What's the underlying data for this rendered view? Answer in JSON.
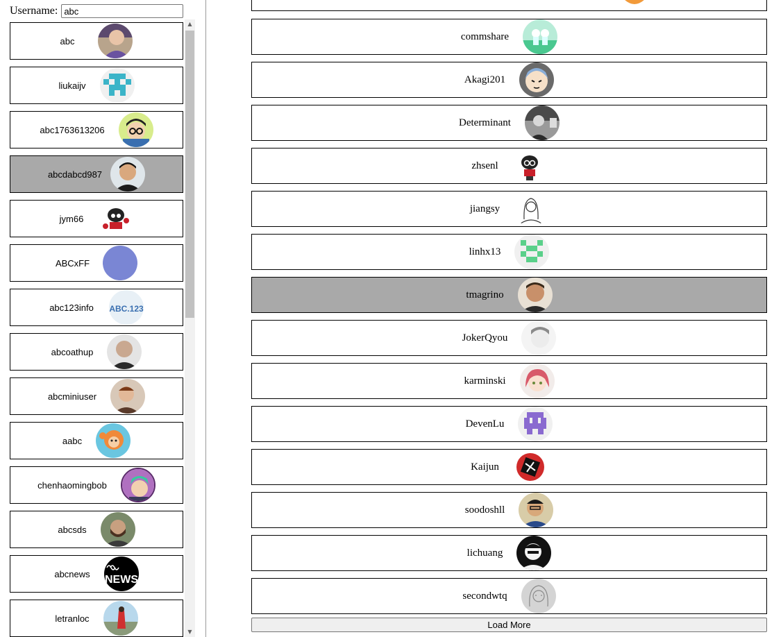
{
  "search": {
    "label": "Username:",
    "value": "abc"
  },
  "results": [
    {
      "login": "abc",
      "avatar": "photo-avatar-icon",
      "selected": false
    },
    {
      "login": "liukaijv",
      "avatar": "identicon-icon",
      "selected": false
    },
    {
      "login": "abc1763613206",
      "avatar": "cartoon-avatar-icon",
      "selected": false
    },
    {
      "login": "abcdabcd987",
      "avatar": "photo-avatar-icon",
      "selected": true
    },
    {
      "login": "jym66",
      "avatar": "octocat-icon",
      "selected": false
    },
    {
      "login": "ABCxFF",
      "avatar": "solid-color-avatar-icon",
      "selected": false
    },
    {
      "login": "abc123info",
      "avatar": "text-logo-avatar-icon",
      "selected": false
    },
    {
      "login": "abcoathup",
      "avatar": "photo-avatar-icon",
      "selected": false
    },
    {
      "login": "abcminiuser",
      "avatar": "photo-avatar-icon",
      "selected": false
    },
    {
      "login": "aabc",
      "avatar": "cartoon-avatar-icon",
      "selected": false
    },
    {
      "login": "chenhaomingbob",
      "avatar": "cartoon-avatar-icon",
      "selected": false
    },
    {
      "login": "abcsds",
      "avatar": "photo-avatar-icon",
      "selected": false
    },
    {
      "login": "abcnews",
      "avatar": "news-logo-icon",
      "logo_text": "NEWS",
      "selected": false
    },
    {
      "login": "letranloc",
      "avatar": "photo-avatar-icon",
      "selected": false
    }
  ],
  "followers": [
    {
      "login": "",
      "avatar": "cartoon-avatar-icon",
      "selected": false
    },
    {
      "login": "commshare",
      "avatar": "cartoon-avatar-icon",
      "selected": false
    },
    {
      "login": "Akagi201",
      "avatar": "cartoon-avatar-icon",
      "selected": false
    },
    {
      "login": "Determinant",
      "avatar": "photo-avatar-icon",
      "selected": false
    },
    {
      "login": "zhsenl",
      "avatar": "octocat-icon",
      "selected": false
    },
    {
      "login": "jiangsy",
      "avatar": "sketch-avatar-icon",
      "selected": false
    },
    {
      "login": "linhx13",
      "avatar": "identicon-icon",
      "selected": false
    },
    {
      "login": "tmagrino",
      "avatar": "photo-avatar-icon",
      "selected": true
    },
    {
      "login": "JokerQyou",
      "avatar": "photo-avatar-icon",
      "selected": false
    },
    {
      "login": "karminski",
      "avatar": "cartoon-avatar-icon",
      "selected": false
    },
    {
      "login": "DevenLu",
      "avatar": "identicon-icon",
      "selected": false
    },
    {
      "login": "Kaijun",
      "avatar": "graphic-avatar-icon",
      "selected": false
    },
    {
      "login": "soodoshll",
      "avatar": "photo-avatar-icon",
      "selected": false
    },
    {
      "login": "lichuang",
      "avatar": "photo-avatar-icon",
      "selected": false
    },
    {
      "login": "secondwtq",
      "avatar": "sketch-avatar-icon",
      "selected": false
    }
  ],
  "load_more_label": "Load More",
  "colors": {
    "selected_bg": "#a9a9a9",
    "card_border": "#000000",
    "scrollbar_track": "#f1f1f1",
    "scrollbar_thumb": "#c1c1c1"
  }
}
